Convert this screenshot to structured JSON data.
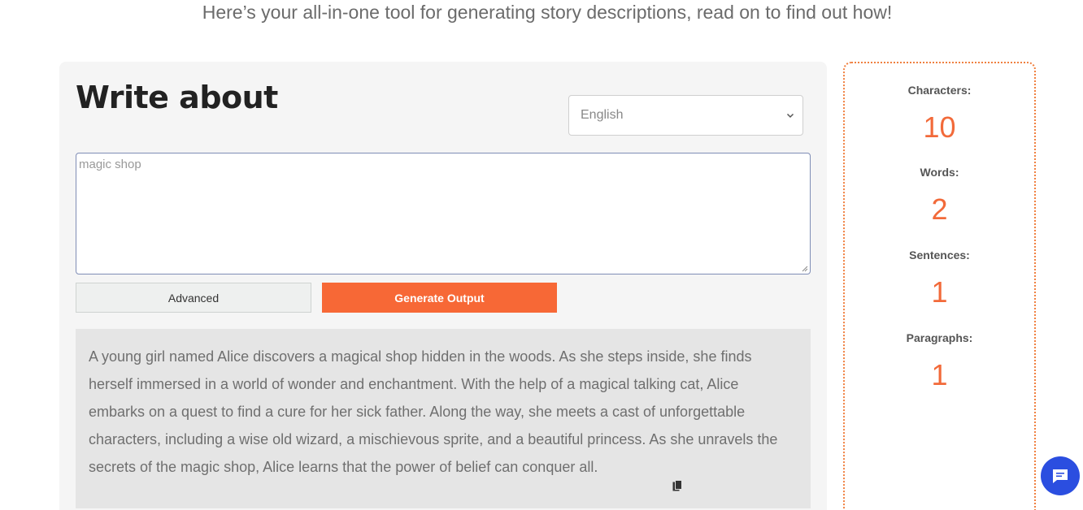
{
  "intro": "Here’s your all-in-one tool for generating story descriptions, read on to find out how!",
  "form": {
    "title": "Write about",
    "language": {
      "selected": "English"
    },
    "input": {
      "value": "magic shop"
    },
    "advanced_label": "Advanced",
    "generate_label": "Generate Output"
  },
  "output": {
    "text": "A young girl named Alice discovers a magical shop hidden in the woods. As she steps inside, she finds herself immersed in a world of wonder and enchantment. With the help of a magical talking cat, Alice embarks on a quest to find a cure for her sick father. Along the way, she meets a cast of unforgettable characters, including a wise old wizard, a mischievous sprite, and a beautiful princess. As she unravels the secrets of the magic shop, Alice learns that the power of belief can conquer all."
  },
  "stats": {
    "characters_label": "Characters:",
    "characters_value": "10",
    "words_label": "Words:",
    "words_value": "2",
    "sentences_label": "Sentences:",
    "sentences_value": "1",
    "paragraphs_label": "Paragraphs:",
    "paragraphs_value": "1"
  },
  "colors": {
    "accent": "#f76836",
    "stat_value": "#f26a3a",
    "chat": "#2b4ee0"
  },
  "icons": {
    "dropdown": "chevron-down-icon",
    "copy": "copy-icon",
    "chat": "chat-icon"
  }
}
